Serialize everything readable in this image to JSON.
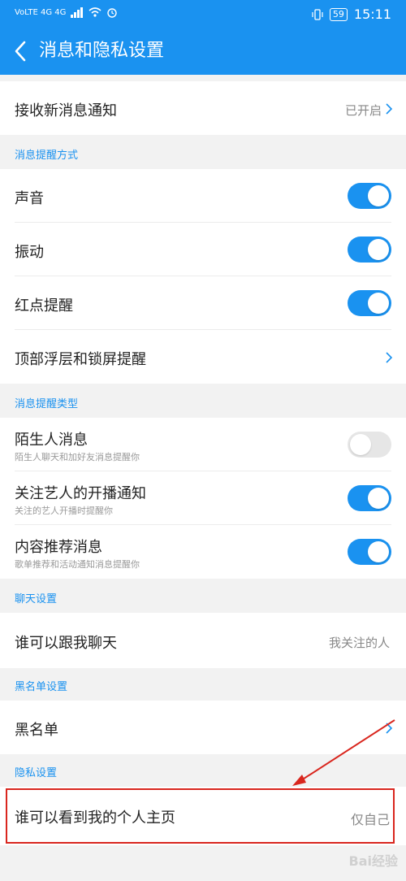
{
  "status_bar": {
    "network": "VoLTE 4G 4G",
    "time": "15:11",
    "battery": "59"
  },
  "header": {
    "title": "消息和隐私设置"
  },
  "notification": {
    "label": "接收新消息通知",
    "value": "已开启"
  },
  "reminder_method": {
    "section_title": "消息提醒方式",
    "sound": "声音",
    "vibration": "振动",
    "red_dot": "红点提醒",
    "top_float": "顶部浮层和锁屏提醒"
  },
  "reminder_type": {
    "section_title": "消息提醒类型",
    "stranger": "陌生人消息",
    "stranger_sub": "陌生人聊天和加好友消息提醒你",
    "artist": "关注艺人的开播通知",
    "artist_sub": "关注的艺人开播时提醒你",
    "recommend": "内容推荐消息",
    "recommend_sub": "歌单推荐和活动通知消息提醒你"
  },
  "toggles": {
    "sound": true,
    "vibration": true,
    "red_dot": true,
    "stranger": false,
    "artist": true,
    "recommend": true
  },
  "chat": {
    "section_title": "聊天设置",
    "who_can_chat": "谁可以跟我聊天",
    "who_can_chat_value": "我关注的人"
  },
  "blacklist": {
    "section_title": "黑名单设置",
    "label": "黑名单"
  },
  "privacy": {
    "section_title": "隐私设置",
    "who_can_view": "谁可以看到我的个人主页",
    "who_can_view_value": "仅自己"
  },
  "watermark": "Bai经验",
  "colors": {
    "accent": "#1a92f0",
    "annotation": "#d9261e"
  }
}
